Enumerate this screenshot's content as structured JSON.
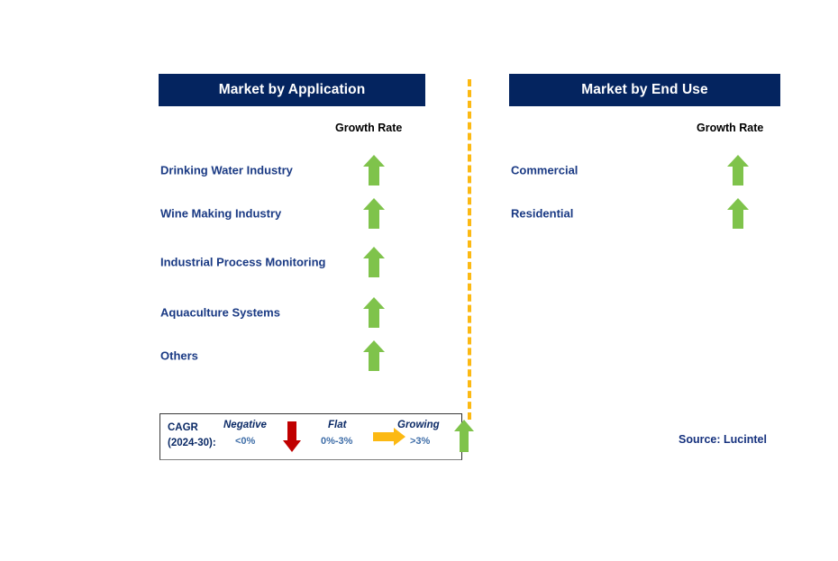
{
  "colors": {
    "header_navy": "#04245F",
    "label_navy": "#1A3A84",
    "arrow_green": "#7FC34B",
    "arrow_red": "#C00000",
    "arrow_amber": "#FCB913",
    "divider_amber": "#FCB913",
    "legend_value_blue": "#3F6EA8",
    "source_navy": "#15317E"
  },
  "panels": [
    {
      "id": "market-by-application",
      "title": "Market by Application",
      "growth_rate_header": "Growth Rate",
      "rows": [
        {
          "label": "Drinking Water Industry",
          "growth": "Growing",
          "icon": "arrow-up-icon"
        },
        {
          "label": "Wine Making Industry",
          "growth": "Growing",
          "icon": "arrow-up-icon"
        },
        {
          "label": "Industrial Process Monitoring",
          "growth": "Growing",
          "icon": "arrow-up-icon"
        },
        {
          "label": "Aquaculture Systems",
          "growth": "Growing",
          "icon": "arrow-up-icon"
        },
        {
          "label": "Others",
          "growth": "Growing",
          "icon": "arrow-up-icon"
        }
      ]
    },
    {
      "id": "market-by-end-use",
      "title": "Market by End Use",
      "growth_rate_header": "Growth Rate",
      "rows": [
        {
          "label": "Commercial",
          "growth": "Growing",
          "icon": "arrow-up-icon"
        },
        {
          "label": "Residential",
          "growth": "Growing",
          "icon": "arrow-up-icon"
        }
      ]
    }
  ],
  "legend": {
    "cagr_line1": "CAGR",
    "cagr_line2": "(2024-30):",
    "items": [
      {
        "name": "Negative",
        "value": "<0%",
        "icon": "arrow-down-icon"
      },
      {
        "name": "Flat",
        "value": "0%-3%",
        "icon": "arrow-right-icon"
      },
      {
        "name": "Growing",
        "value": ">3%",
        "icon": "arrow-up-icon"
      }
    ]
  },
  "source": "Source: Lucintel"
}
